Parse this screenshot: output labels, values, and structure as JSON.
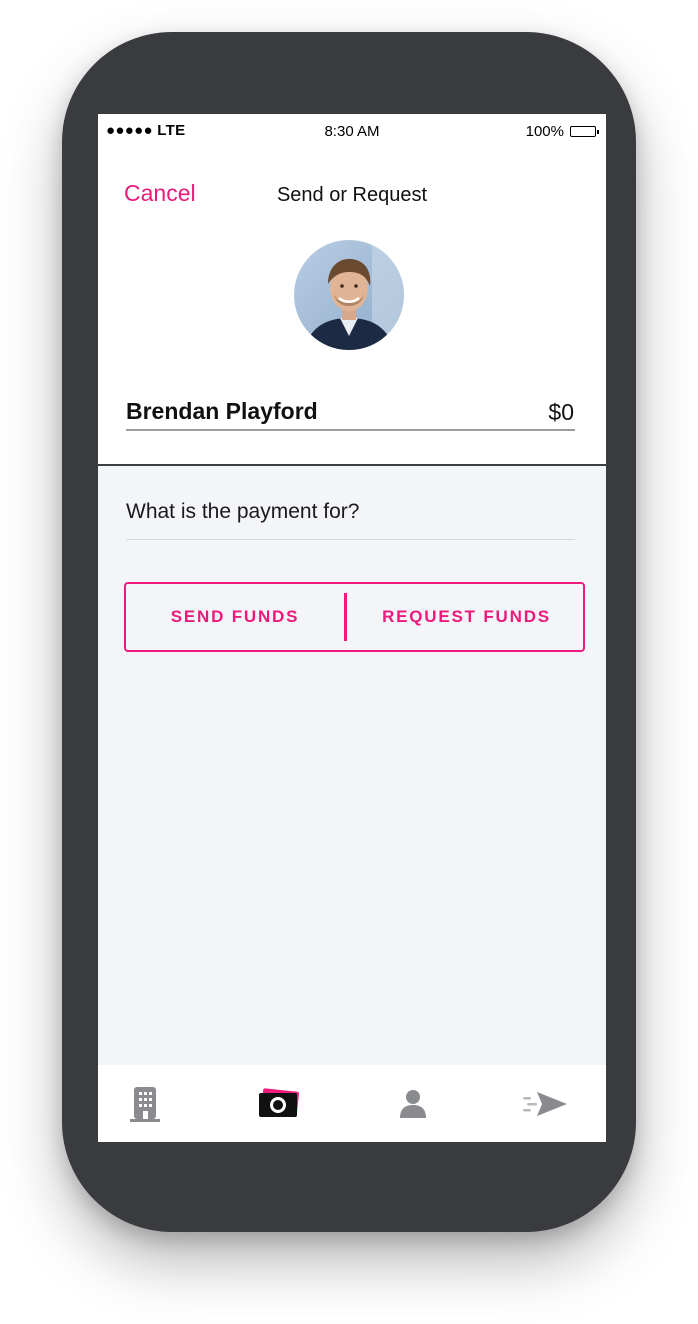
{
  "status_bar": {
    "carrier": "●●●●● LTE",
    "time": "8:30 AM",
    "battery": "100%"
  },
  "header": {
    "cancel_label": "Cancel",
    "title": "Send or Request"
  },
  "recipient": {
    "name": "Brendan Playford",
    "amount": "$0"
  },
  "memo": {
    "placeholder": "What is the payment for?"
  },
  "actions": {
    "send_label": "SEND FUNDS",
    "request_label": "REQUEST FUNDS"
  },
  "tab_bar": {
    "items": [
      {
        "icon": "building-icon",
        "active": false
      },
      {
        "icon": "cash-icon",
        "active": true
      },
      {
        "icon": "person-icon",
        "active": false
      },
      {
        "icon": "paper-plane-icon",
        "active": false
      }
    ]
  },
  "colors": {
    "accent": "#ec1a7a",
    "phone_frame": "#3a3b3f",
    "screen_bg": "#f4f5f9",
    "icon_gray": "#8a8b8f"
  }
}
